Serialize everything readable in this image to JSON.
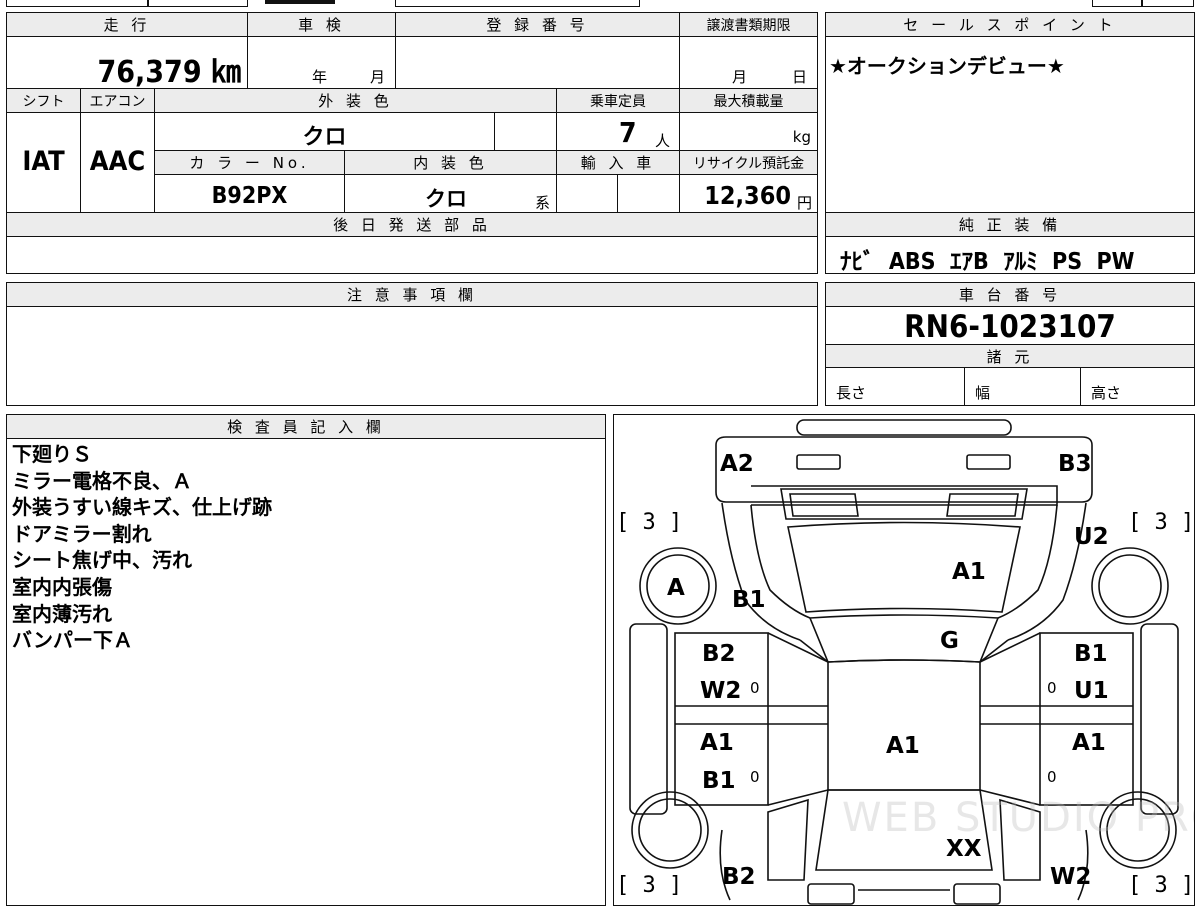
{
  "header": {
    "mileage_label": "走 行",
    "inspection_label": "車 検",
    "registration_label": "登 録 番 号",
    "transfer_deadline_label": "譲渡書類期限",
    "sales_point_label": "セ ー ル ス ポ イ ン ト",
    "mileage_value": "76,379 ㎞",
    "year_unit": "年",
    "month_unit": "月",
    "deadline_month": "月",
    "deadline_day": "日",
    "sales_point_text": "★オークションデビュー★"
  },
  "specs": {
    "shift_label": "シフト",
    "aircon_label": "エアコン",
    "exterior_color_label": "外 装 色",
    "capacity_label": "乗車定員",
    "max_load_label": "最大積載量",
    "shift_value": "IAT",
    "aircon_value": "AAC",
    "exterior_color_value": "クロ",
    "capacity_value": "7",
    "capacity_unit": "人",
    "load_unit": "kg",
    "color_no_label": "カ ラ ー No.",
    "interior_color_label": "内 装 色",
    "import_label": "輸 入 車",
    "recycle_label": "リサイクル預託金",
    "color_no_value": "B92PX",
    "interior_color_value": "クロ",
    "interior_suffix": "系",
    "recycle_value": "12,360",
    "recycle_unit": "円"
  },
  "later_parts_label": "後 日 発 送 部 品",
  "genuine_equipment": {
    "label": "純 正 装 備",
    "items": "ﾅﾋﾞ  ABS  ｴｱB  ｱﾙﾐ  PS  PW"
  },
  "caution_label": "注 意 事 項 欄",
  "chassis": {
    "label": "車 台 番 号",
    "number": "RN6-1023107",
    "specs_label": "諸 元",
    "length_label": "長さ",
    "width_label": "幅",
    "height_label": "高さ"
  },
  "inspector": {
    "label": "検 査 員 記 入 欄",
    "notes": [
      "下廻りＳ",
      "ミラー電格不良、Ａ",
      "外装うすい線キズ、仕上げ跡",
      "ドアミラー割れ",
      "シート焦げ中、汚れ",
      "室内内張傷",
      "室内薄汚れ",
      "バンパー下Ａ"
    ]
  },
  "diagram": {
    "front_left_corner": "A2",
    "front_right_corner": "B3",
    "tire_bracket_tl": "[ 3 ]",
    "tire_bracket_tr": "[ 3 ]",
    "tire_bracket_bl": "[ 3 ]",
    "tire_bracket_br": "[ 3 ]",
    "left_mirror": "A",
    "right_mirror": "U2",
    "left_front_fender": "B1",
    "hood": "A1",
    "windshield": "G",
    "left_front_door_top": "B2",
    "left_front_door_bottom": "W2",
    "right_front_door_top": "B1",
    "right_front_door_bottom": "U1",
    "left_rear_door_top": "A1",
    "left_rear_door_bottom": "B1",
    "right_rear_door": "A1",
    "roof": "A1",
    "rear_glass": "XX",
    "rear_left": "B2",
    "rear_right": "W2",
    "zero_mark": "0",
    "watermark": "WEB STUDIO PRO"
  }
}
